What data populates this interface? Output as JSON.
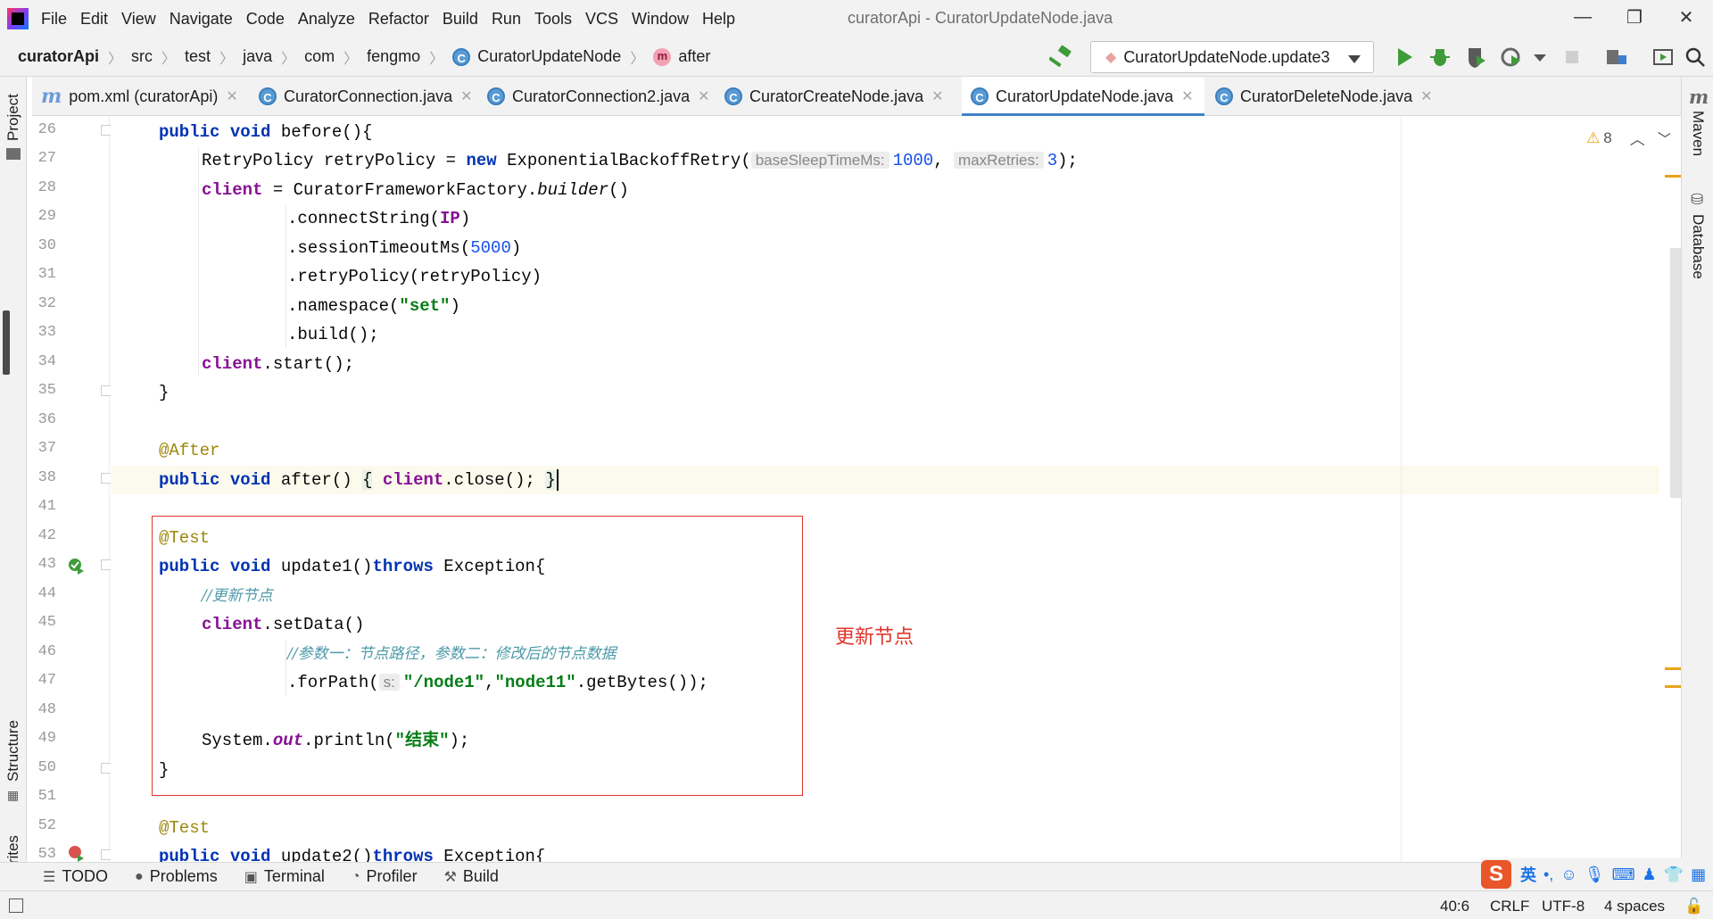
{
  "window": {
    "title": "curatorApi - CuratorUpdateNode.java",
    "minimize": "—",
    "maximize": "❐",
    "close": "✕"
  },
  "menu": [
    "File",
    "Edit",
    "View",
    "Navigate",
    "Code",
    "Analyze",
    "Refactor",
    "Build",
    "Run",
    "Tools",
    "VCS",
    "Window",
    "Help"
  ],
  "breadcrumbs": {
    "project": "curatorApi",
    "items": [
      "src",
      "test",
      "java",
      "com",
      "fengmo"
    ],
    "class_name": "CuratorUpdateNode",
    "method_name": "after",
    "class_icon_glyph": "C",
    "method_icon_glyph": "m"
  },
  "run_config": {
    "label": "CuratorUpdateNode.update3"
  },
  "tabs": [
    {
      "label": "pom.xml (curatorApi)",
      "icon": "maven-icon",
      "glyph": "m",
      "active": false
    },
    {
      "label": "CuratorConnection.java",
      "icon": "class-icon",
      "glyph": "C",
      "active": false
    },
    {
      "label": "CuratorConnection2.java",
      "icon": "class-icon",
      "glyph": "C",
      "active": false
    },
    {
      "label": "CuratorCreateNode.java",
      "icon": "class-icon",
      "glyph": "C",
      "active": false
    },
    {
      "label": "CuratorUpdateNode.java",
      "icon": "class-icon",
      "glyph": "C",
      "active": true
    },
    {
      "label": "CuratorDeleteNode.java",
      "icon": "class-icon",
      "glyph": "C",
      "active": false
    }
  ],
  "left_tools": {
    "project": "Project",
    "structure": "Structure",
    "favorites": "Favorites"
  },
  "right_tools": {
    "maven": "Maven",
    "database": "Database"
  },
  "editor": {
    "warnings_count": "8",
    "line_numbers": [
      "26",
      "27",
      "28",
      "29",
      "30",
      "31",
      "32",
      "33",
      "34",
      "35",
      "36",
      "37",
      "38",
      "41",
      "42",
      "43",
      "44",
      "45",
      "46",
      "47",
      "48",
      "49",
      "50",
      "51",
      "52",
      "53"
    ],
    "hints": {
      "base_sleep": "baseSleepTimeMs:",
      "max_retries": "maxRetries:",
      "s": "s:"
    },
    "code": {
      "l26_pub": "public",
      "l26_void": "void",
      "l26_rest": " before(){",
      "l27_a": "RetryPolicy retryPolicy = ",
      "l27_new": "new",
      "l27_b": " ExponentialBackoffRetry(",
      "l27_v1": "1000",
      "l27_c": ", ",
      "l27_v2": "3",
      "l27_d": ");",
      "l28_client": "client",
      "l28_a": " = CuratorFrameworkFactory.",
      "l28_builder": "builder",
      "l28_b": "()",
      "l29_a": ".connectString(",
      "l29_ip": "IP",
      "l29_b": ")",
      "l30_a": ".sessionTimeoutMs(",
      "l30_v": "5000",
      "l30_b": ")",
      "l31": ".retryPolicy(retryPolicy)",
      "l32_a": ".namespace(",
      "l32_s": "\"set\"",
      "l32_b": ")",
      "l33": ".build();",
      "l34_client": "client",
      "l34_rest": ".start();",
      "l35": "}",
      "l37": "@After",
      "l38_pub": "public",
      "l38_void": "void",
      "l38_a": " after() ",
      "l38_ob": "{",
      "l38_client": "client",
      "l38_b": ".close(); ",
      "l38_cb": "}",
      "l42": "@Test",
      "l43_pub": "public",
      "l43_void": "void",
      "l43_a": " update1()",
      "l43_throws": "throws",
      "l43_b": " Exception{",
      "l44": "//更新节点",
      "l45_client": "client",
      "l45_rest": ".setData()",
      "l46": "//参数一：节点路径，参数二：修改后的节点数据",
      "l47_a": ".forPath(",
      "l47_s1": "\"/node1\"",
      "l47_c": ",",
      "l47_s2": "\"node11\"",
      "l47_b": ".getBytes());",
      "l49_a": "System.",
      "l49_out": "out",
      "l49_b": ".println(",
      "l49_s": "\"结束\"",
      "l49_c": ");",
      "l50": "}",
      "l52": "@Test",
      "l53_pub": "public",
      "l53_void": "void",
      "l53_a": " update2()",
      "l53_throws": "throws",
      "l53_b": " Exception{"
    },
    "annotation_text": "更新节点"
  },
  "bottom_tools": [
    {
      "label": "TODO",
      "icon": "list-icon",
      "glyph": "☰"
    },
    {
      "label": "Problems",
      "icon": "problems-icon",
      "glyph": "●"
    },
    {
      "label": "Terminal",
      "icon": "terminal-icon",
      "glyph": "▣"
    },
    {
      "label": "Profiler",
      "icon": "profiler-icon",
      "glyph": "◔"
    },
    {
      "label": "Build",
      "icon": "build-icon",
      "glyph": "⚒"
    }
  ],
  "ime": {
    "logo": "S",
    "lang": "英",
    "punct": "•,"
  },
  "status": {
    "position": "40:6",
    "line_sep": "CRLF",
    "encoding": "UTF-8",
    "indent": "4 spaces"
  },
  "colors": {
    "accent": "#4083c9",
    "annotation_red": "#e0362c",
    "keyword": "#0033b3",
    "string": "#067d17",
    "number": "#1750eb",
    "field": "#871094",
    "run_green": "#3e9b39"
  }
}
